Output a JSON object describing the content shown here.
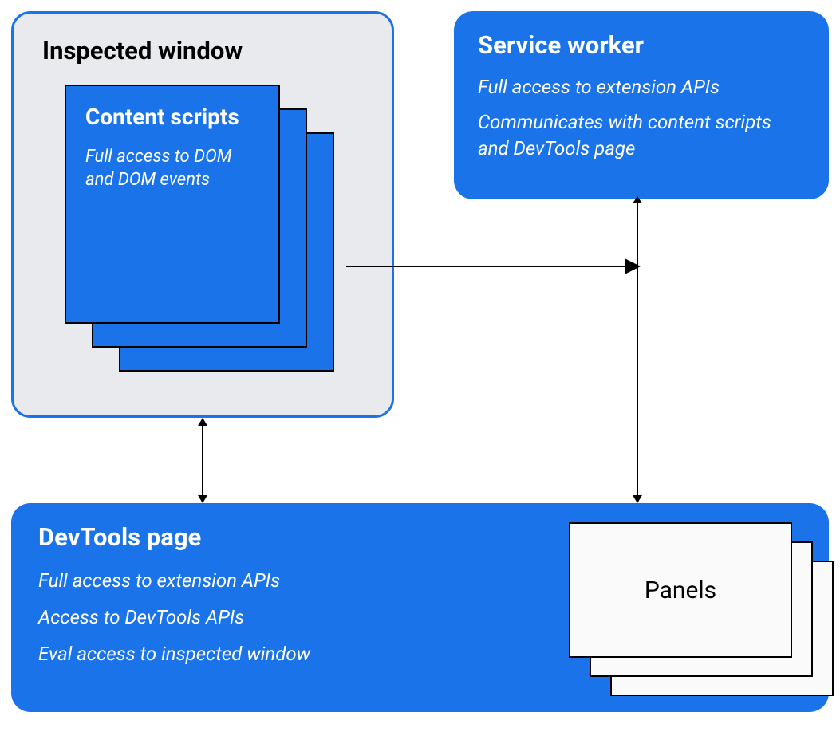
{
  "inspected_window": {
    "title": "Inspected window",
    "content_scripts": {
      "title": "Content scripts",
      "description": "Full access to DOM and DOM events"
    }
  },
  "service_worker": {
    "title": "Service worker",
    "desc1": "Full access to extension APIs",
    "desc2": "Communicates with content scripts and DevTools page"
  },
  "devtools_page": {
    "title": "DevTools page",
    "desc1": "Full access to extension APIs",
    "desc2": "Access to DevTools APIs",
    "desc3": "Eval access to inspected window",
    "panels": {
      "title": "Panels"
    }
  }
}
